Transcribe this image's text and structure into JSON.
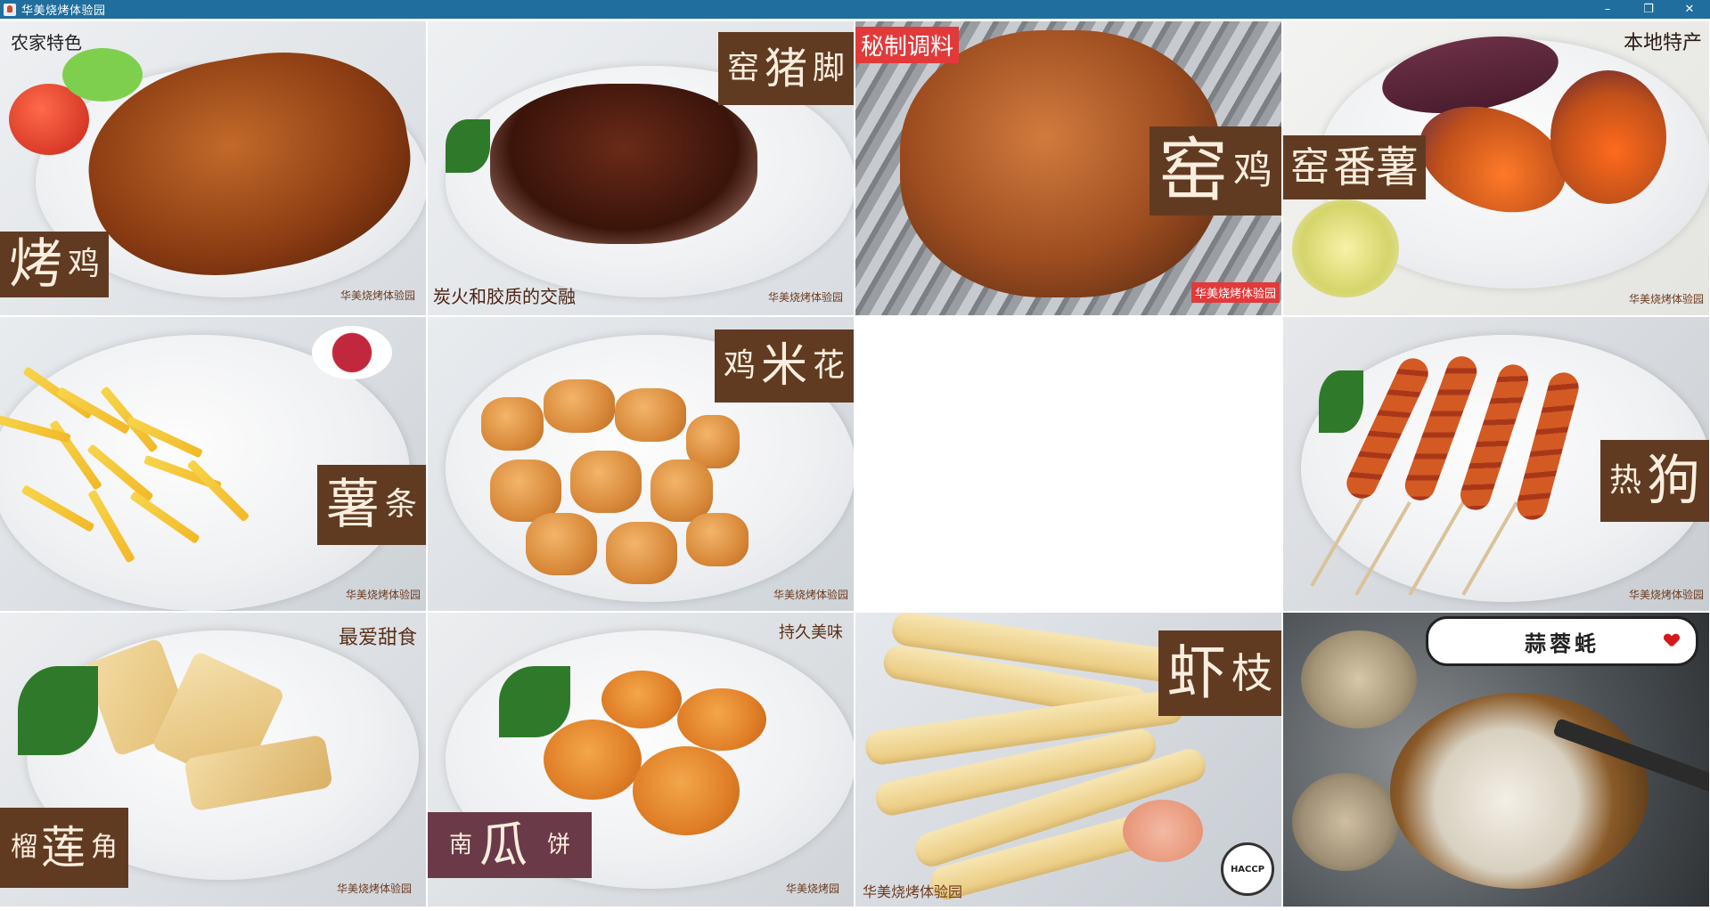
{
  "window": {
    "title": "华美烧烤体验园",
    "controls": {
      "minimize": "–",
      "maximize": "❐",
      "close": "✕"
    }
  },
  "tiles": [
    {
      "big": "烤",
      "small": "鸡",
      "corner": "农家特色",
      "watermark": "华美烧烤体验园"
    },
    {
      "big": "猪",
      "pre": "窑",
      "small": "脚",
      "corner": "炭火和胶质的交融",
      "watermark": "华美烧烤体验园"
    },
    {
      "big": "窑",
      "small": "鸡",
      "tag": "秘制调料",
      "watermark": "华美烧烤体验园"
    },
    {
      "big": "番薯",
      "pre": "窑",
      "corner": "本地特产",
      "watermark": "华美烧烤体验园"
    },
    {
      "big": "薯",
      "small": "条",
      "watermark": "华美烧烤体验园"
    },
    {
      "big": "米",
      "pre": "鸡",
      "small": "花",
      "watermark": "华美烧烤体验园"
    },
    {
      "empty": true
    },
    {
      "big": "狗",
      "pre": "热",
      "watermark": "华美烧烤体验园"
    },
    {
      "big": "莲",
      "pre": "榴",
      "small": "角",
      "corner": "最爱甜食",
      "watermark": "华美烧烤体验园"
    },
    {
      "big": "瓜",
      "pre": "南",
      "small": "饼",
      "corner": "持久美味",
      "watermark": "华美烧烤园"
    },
    {
      "big": "虾",
      "small": "枝",
      "watermark": "华美烧烤体验园",
      "badge": "HACCP"
    },
    {
      "bubble": "蒜蓉蚝"
    }
  ]
}
